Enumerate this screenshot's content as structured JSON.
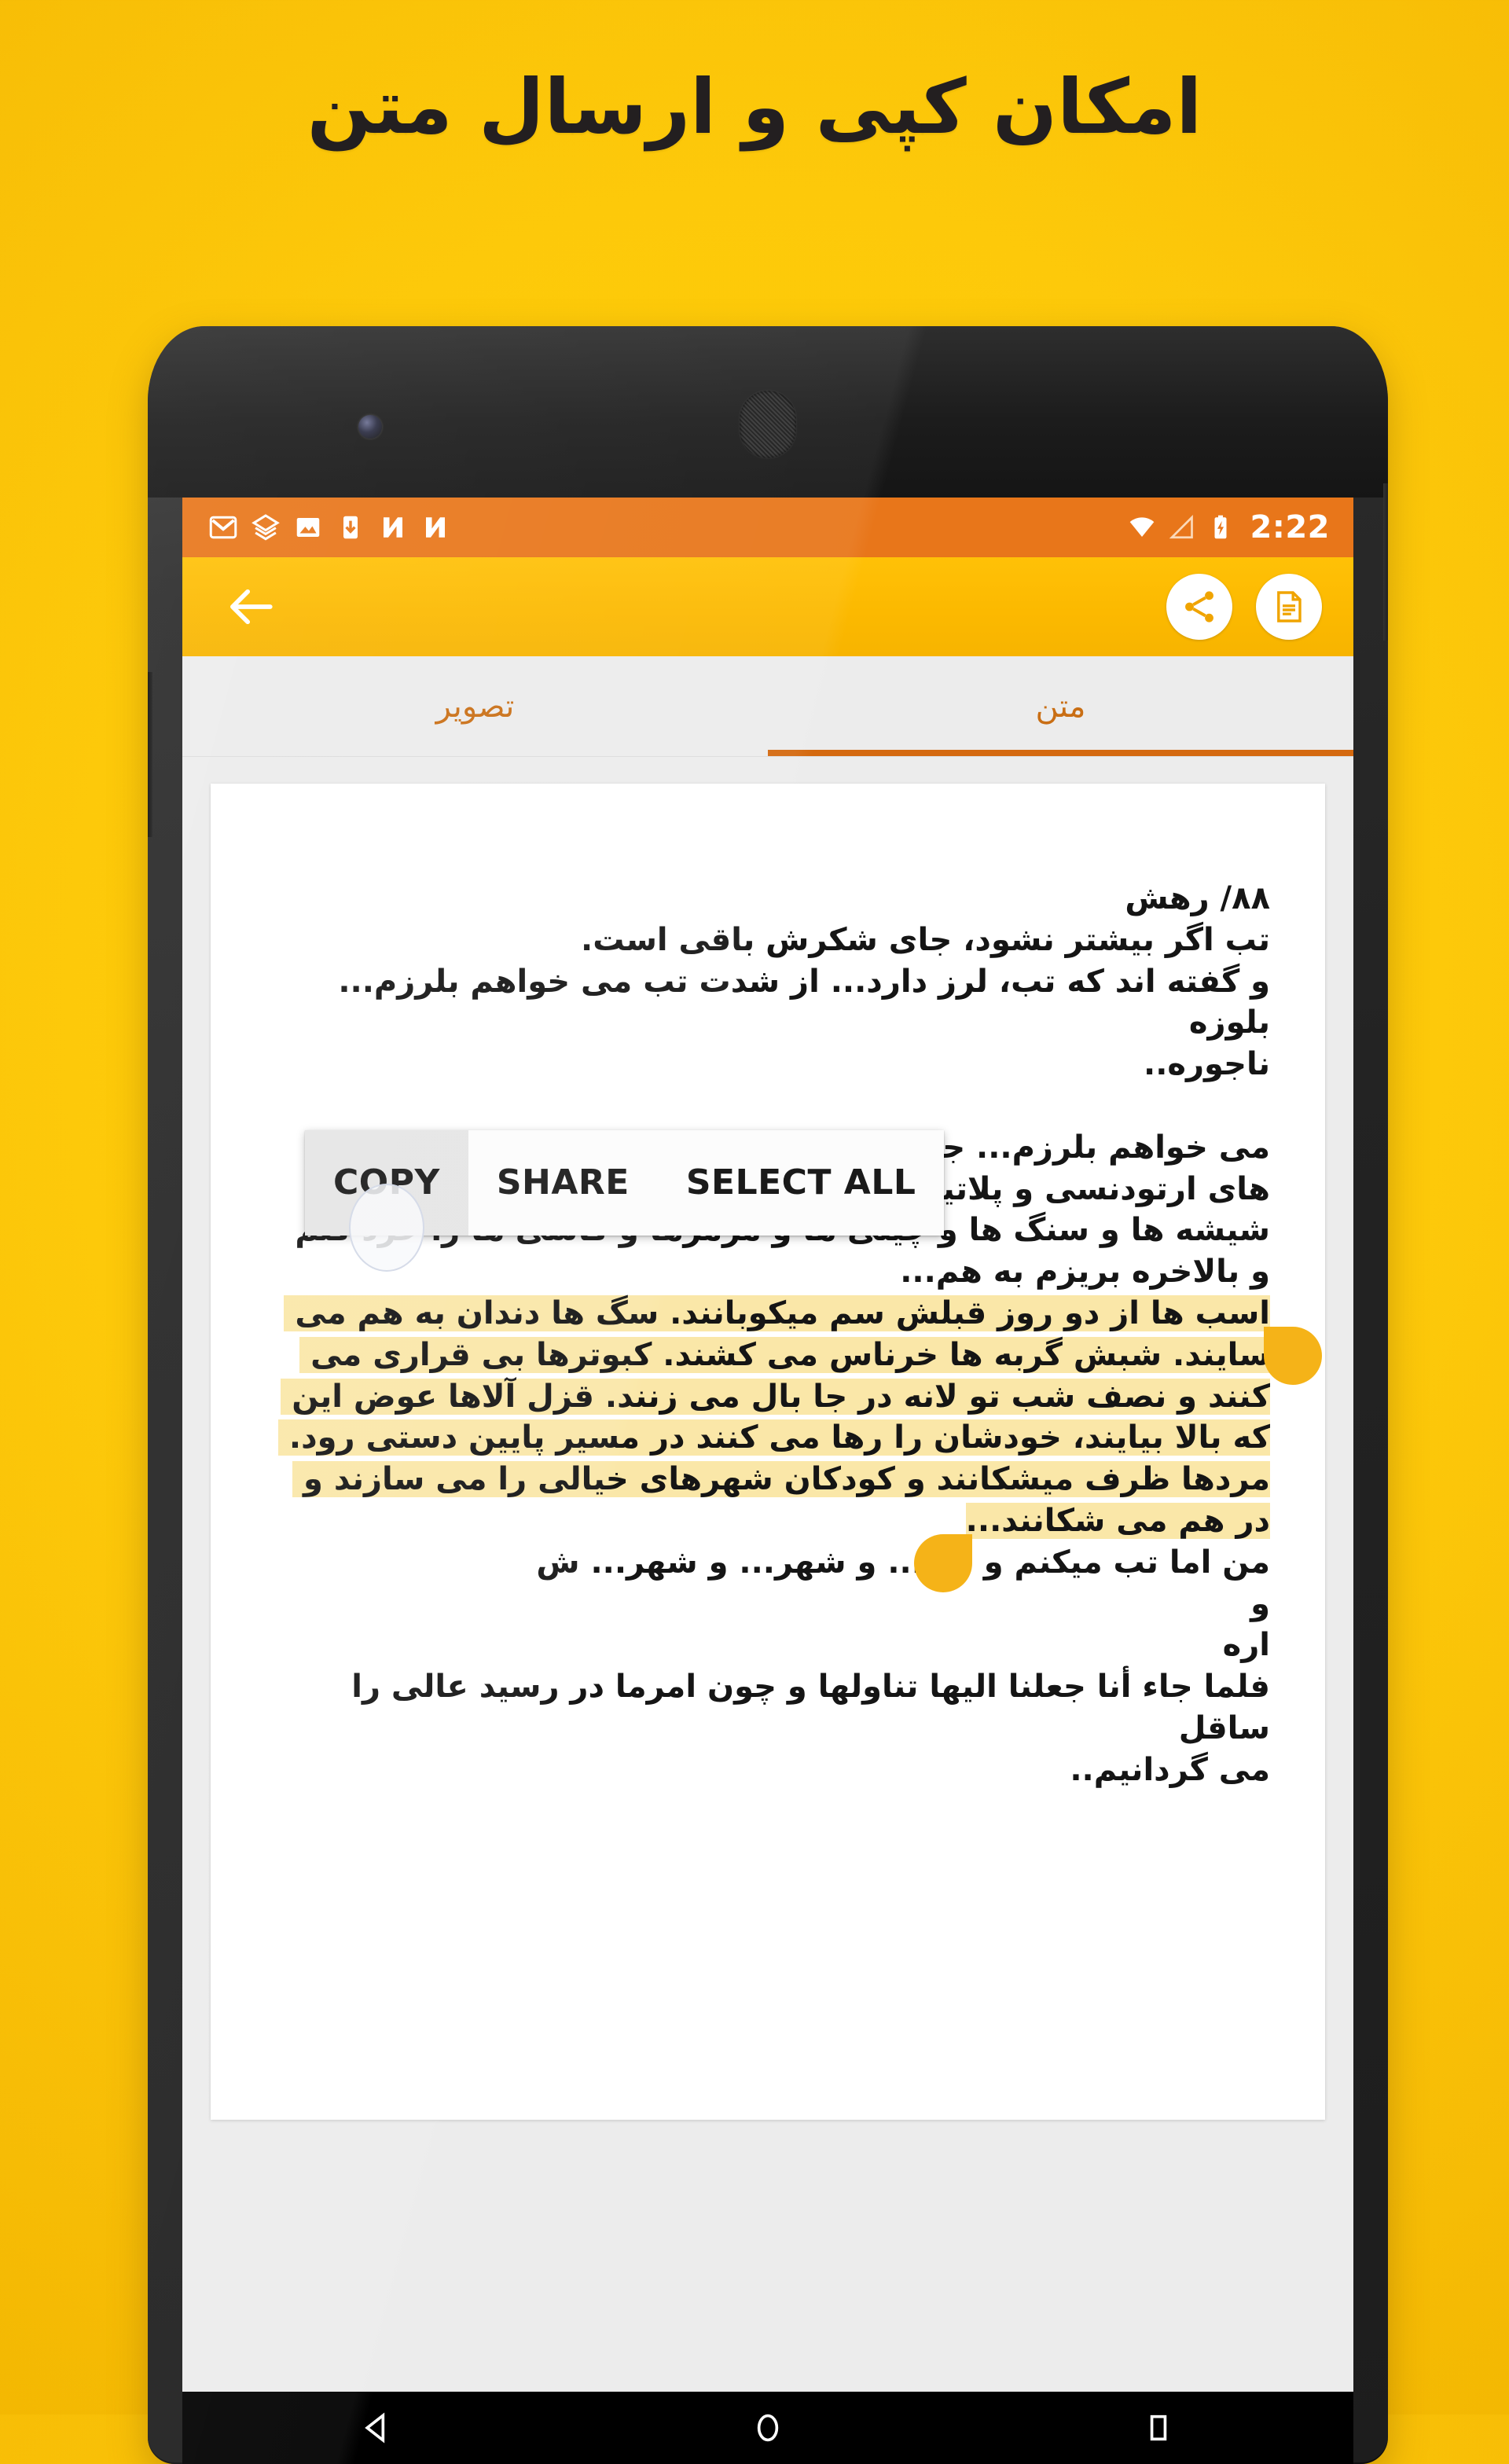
{
  "promo": {
    "headline": "امکان کپی و ارسال متن"
  },
  "phone": {
    "hardware": {
      "camera": "front-camera",
      "earpiece": "earpiece-speaker",
      "volume_button": "volume-rocker",
      "power_button": "power-button"
    }
  },
  "statusbar": {
    "background": "#E8761A",
    "time": "2:22",
    "left_icons": [
      {
        "name": "gmail-icon",
        "label": "M"
      },
      {
        "name": "layers-icon",
        "label": "layers"
      },
      {
        "name": "gallery-image-icon",
        "label": "image"
      },
      {
        "name": "download-to-device-icon",
        "label": "download"
      },
      {
        "name": "n-app-icon-1",
        "label": "N"
      },
      {
        "name": "n-app-icon-2",
        "label": "N"
      }
    ],
    "right_icons": [
      {
        "name": "wifi-icon",
        "label": "wifi"
      },
      {
        "name": "cellular-signal-icon",
        "label": "signal"
      },
      {
        "name": "battery-charging-icon",
        "label": "battery"
      }
    ]
  },
  "appbar": {
    "background": "#FFC107",
    "back_label": "back",
    "actions": [
      {
        "name": "share-button",
        "label": "share"
      },
      {
        "name": "document-text-button",
        "label": "document"
      }
    ]
  },
  "tabs": {
    "accent": "#D4690F",
    "items": [
      {
        "label": "متن",
        "active": true
      },
      {
        "label": "تصویر",
        "active": false
      }
    ]
  },
  "document": {
    "selection_color": "#FAE7A8",
    "paragraphs": [
      {
        "text": "۸۸/ رهش",
        "selected": false
      },
      {
        "text": "تب اگر بیشتر نشود، جای شکرش باقی است.",
        "selected": false
      },
      {
        "text": "و گفته اند که تب، لرز دارد... از شدت تب می خواهم بلرزم...",
        "selected": false
      },
      {
        "text": "بلوزه",
        "selected": false
      },
      {
        "text": "ناجوره..",
        "selected": false
      },
      {
        "text": "",
        "selected": false
      },
      {
        "text": "می خواهم بلرزم... جوری که همه ی لنزها و ایمپلنت ها و سیم های ارتودنسی و پلاتین ها را بیرون بریزم ... جوری که همه ی شیشه ها و سنگ ها و چینی ها و مرمرها و کاشی ها را خرد کنم و بالاخره بریزم به هم...",
        "selected": false
      },
      {
        "text": "اسب ها از دو روز قبلش سم میکوبانند. سگ ها دندان به هم می سایند. شبش گربه ها خرناس می کشند. کبوترها بی قراری می کنند و نصف شب تو لانه در جا بال می زنند. قزل آلاها عوض این که بالا بیایند، خودشان را رها می کنند در مسیر پایین دستی رود. مردها ظرف میشکانند و کودکان شهرهای خیالی را می سازند و در هم می شکانند...",
        "selected": true
      },
      {
        "text": "من اما تب میکنم و لرز... و شهر... و شهر... ش",
        "selected": false
      },
      {
        "text": "و",
        "selected": false
      },
      {
        "text": "اره",
        "selected": false
      },
      {
        "text": "فلما جاء أنا جعلنا اليها تناولها و چون امرما در رسید عالی را ساقل",
        "selected": false
      },
      {
        "text": "می گردانیم..",
        "selected": false
      }
    ]
  },
  "context_menu": {
    "items": [
      {
        "label": "COPY",
        "pressed": true
      },
      {
        "label": "SHARE",
        "pressed": false
      },
      {
        "label": "SELECT ALL",
        "pressed": false
      }
    ]
  },
  "navbar": {
    "buttons": [
      {
        "name": "nav-back-button",
        "label": "back"
      },
      {
        "name": "nav-home-button",
        "label": "home"
      },
      {
        "name": "nav-recents-button",
        "label": "recents"
      }
    ]
  }
}
